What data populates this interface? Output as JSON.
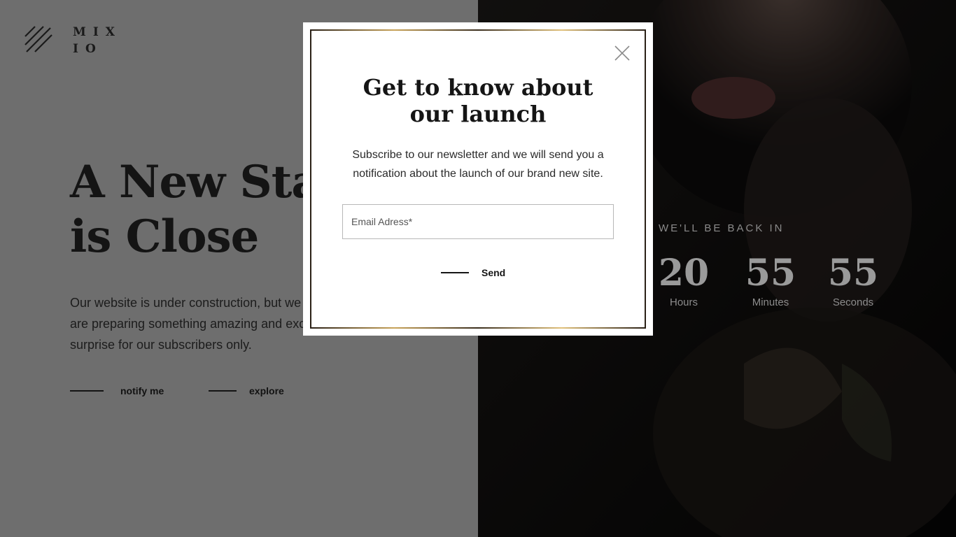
{
  "brand": {
    "logo_line1": "MIX",
    "logo_line2": "IO"
  },
  "hero": {
    "title_line1": "A New Start",
    "title_line2": "is Close",
    "description": "Our website is under construction, but we are ready to go! We are preparing something amazing and exciting for you. Special surprise for our subscribers only."
  },
  "actions": {
    "notify_label": "notify me",
    "explore_label": "explore"
  },
  "countdown": {
    "label": "WE'LL BE BACK IN",
    "hours": {
      "value": "20",
      "unit": "Hours"
    },
    "minutes": {
      "value": "55",
      "unit": "Minutes"
    },
    "seconds": {
      "value": "55",
      "unit": "Seconds"
    }
  },
  "modal": {
    "title": "Get to know about our launch",
    "text": "Subscribe to our newsletter and we will send you a notification about the launch of our brand new site.",
    "email_placeholder": "Email Adress*",
    "email_value": "",
    "send_label": "Send",
    "close_icon": "close-icon"
  },
  "colors": {
    "overlay": "#6e6e6e",
    "text_dark": "#141414",
    "gold_accent": "#c9a45a"
  }
}
